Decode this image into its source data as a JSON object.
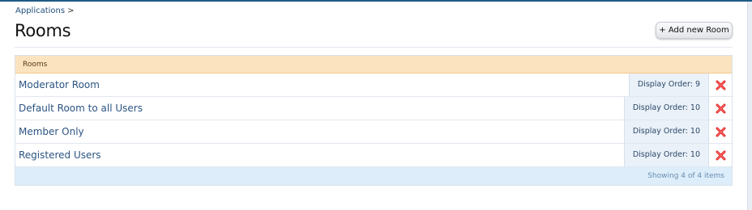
{
  "breadcrumb": {
    "item": "Applications",
    "separator": ">"
  },
  "page": {
    "title": "Rooms"
  },
  "toolbar": {
    "add_label": "+ Add new Room"
  },
  "list": {
    "header": "Rooms",
    "rows": [
      {
        "title": "Moderator Room",
        "order": "Display Order: 9"
      },
      {
        "title": "Default Room to all Users",
        "order": "Display Order: 10"
      },
      {
        "title": "Member Only",
        "order": "Display Order: 10"
      },
      {
        "title": "Registered Users",
        "order": "Display Order: 10"
      }
    ],
    "footer": "Showing 4 of 4 items",
    "delete_icon": "delete-icon"
  },
  "colors": {
    "header_bg": "#fbe3c0",
    "link": "#2b5482",
    "footer_bg": "#ddeefa",
    "delete_red": "#e02a2a",
    "top_bar": "#1f5a86"
  }
}
